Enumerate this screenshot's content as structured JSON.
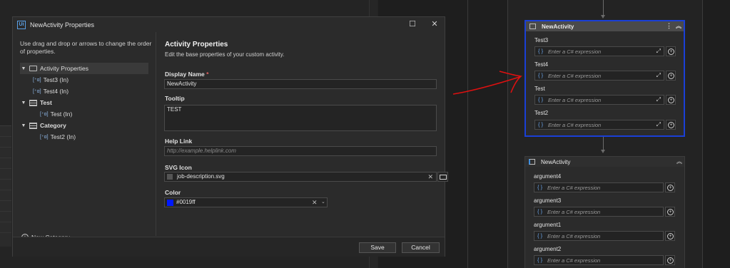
{
  "dialog": {
    "title": "NewActivity Properties",
    "hint": "Use drag and drop or arrows to change the order of properties.",
    "tree": [
      {
        "label": "Activity Properties",
        "kind": "root"
      },
      {
        "label": "Test3 (In)",
        "kind": "arg"
      },
      {
        "label": "Test4 (In)",
        "kind": "arg"
      },
      {
        "label": "Test",
        "kind": "category"
      },
      {
        "label": "Test (In)",
        "kind": "arg-nested"
      },
      {
        "label": "Category",
        "kind": "category"
      },
      {
        "label": "Test2 (In)",
        "kind": "arg-nested"
      }
    ],
    "new_category": "New Category",
    "heading": "Activity Properties",
    "subheading": "Edit the base properties of your custom activity.",
    "display_name_label": "Display Name",
    "display_name_required": "*",
    "display_name_value": "NewActivity",
    "tooltip_label": "Tooltip",
    "tooltip_value": "TEST",
    "help_link_label": "Help Link",
    "help_link_placeholder": "http://example.helplink.com",
    "svg_icon_label": "SVG Icon",
    "svg_icon_value": "job-description.svg",
    "color_label": "Color",
    "color_value": "#0019ff",
    "save_label": "Save",
    "cancel_label": "Cancel"
  },
  "workflow": {
    "selected_card": {
      "title": "NewActivity",
      "args": [
        {
          "label": "Test3",
          "placeholder": "Enter a C# expression"
        },
        {
          "label": "Test4",
          "placeholder": "Enter a C# expression"
        },
        {
          "label": "Test",
          "placeholder": "Enter a C# expression"
        },
        {
          "label": "Test2",
          "placeholder": "Enter a C# expression"
        }
      ]
    },
    "second_card": {
      "title": "NewActivity",
      "args": [
        {
          "label": "argument4",
          "placeholder": "Enter a C# expression"
        },
        {
          "label": "argument3",
          "placeholder": "Enter a C# expression"
        },
        {
          "label": "argument1",
          "placeholder": "Enter a C# expression"
        },
        {
          "label": "argument2",
          "placeholder": "Enter a C# expression"
        }
      ]
    }
  },
  "colors": {
    "selection_border": "#1a3fd6",
    "swatch": "#0019ff",
    "annotation": "#e01010"
  }
}
